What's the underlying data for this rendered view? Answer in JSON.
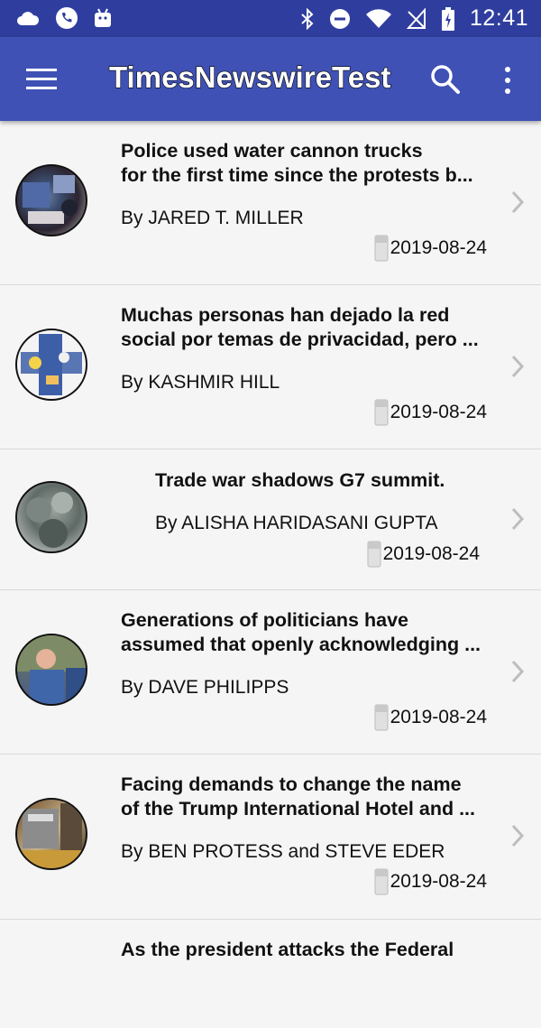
{
  "status_bar": {
    "time": "12:41",
    "left_icons": [
      "cloud-icon",
      "phone-call-icon",
      "android-icon"
    ],
    "right_icons": [
      "bluetooth-icon",
      "do-not-disturb-icon",
      "wifi-icon",
      "no-signal-icon",
      "battery-charging-icon"
    ]
  },
  "app_bar": {
    "title": "TimesNewswireTest",
    "menu_icon": "hamburger-menu-icon",
    "search_icon": "search-icon",
    "more_icon": "more-vert-icon"
  },
  "colors": {
    "status_bar": "#2f3e9e",
    "app_bar": "#3f51b5",
    "background": "#f5f5f5",
    "divider": "#d9d9d9"
  },
  "articles": [
    {
      "title_line1": "Police used water cannon trucks",
      "title_line2": "for the first time since the protests b...",
      "byline": "By JARED T. MILLER",
      "date": "2019-08-24"
    },
    {
      "title_line1": "Muchas personas han dejado la red",
      "title_line2": "social por temas de privacidad, pero ...",
      "byline": "By KASHMIR HILL",
      "date": "2019-08-24"
    },
    {
      "title_line1": "Trade war shadows G7 summit.",
      "title_line2": "",
      "byline": "By ALISHA HARIDASANI GUPTA",
      "date": "2019-08-24"
    },
    {
      "title_line1": "Generations of politicians have",
      "title_line2": "assumed that openly acknowledging ...",
      "byline": "By DAVE PHILIPPS",
      "date": "2019-08-24"
    },
    {
      "title_line1": "Facing demands to change the name",
      "title_line2": "of the Trump International Hotel and ...",
      "byline": "By BEN PROTESS and STEVE EDER",
      "date": "2019-08-24"
    },
    {
      "title_line1": "As the president attacks the Federal",
      "title_line2": "",
      "byline": "",
      "date": ""
    }
  ]
}
